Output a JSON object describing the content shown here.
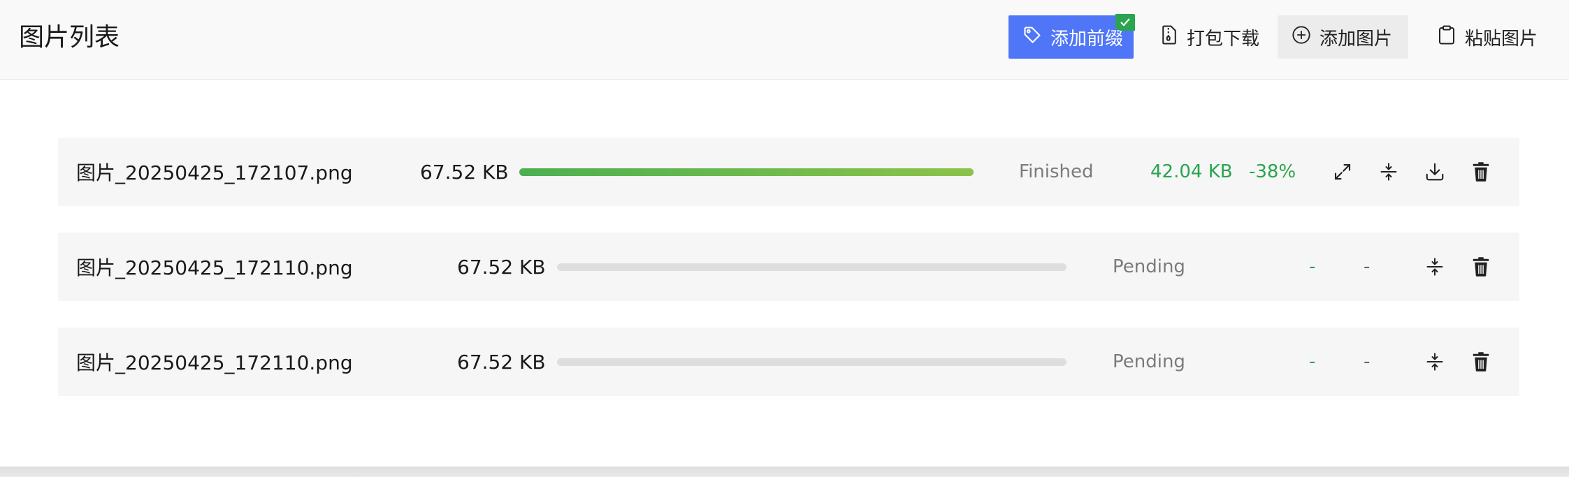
{
  "header": {
    "title": "图片列表",
    "buttons": {
      "add_prefix": "添加前缀",
      "zip_download": "打包下载",
      "add_image": "添加图片",
      "paste_image": "粘贴图片"
    },
    "add_prefix_active": true
  },
  "colors": {
    "accent": "#4f76f6",
    "success": "#2aa44f",
    "progress_start": "#4caf50",
    "progress_end": "#8bc34a"
  },
  "rows": [
    {
      "filename": "图片_20250425_172107.png",
      "size": "67.52 KB",
      "progress": 1.0,
      "status": "Finished",
      "compressed_size": "42.04 KB",
      "ratio": "-38%",
      "actions": [
        "expand-icon",
        "compress-icon",
        "download-icon",
        "trash-icon"
      ]
    },
    {
      "filename": "图片_20250425_172110.png",
      "size": "67.52 KB",
      "progress": 0.0,
      "status": "Pending",
      "compressed_size": "-",
      "ratio": "-",
      "actions": [
        "compress-icon",
        "trash-icon"
      ]
    },
    {
      "filename": "图片_20250425_172110.png",
      "size": "67.52 KB",
      "progress": 0.0,
      "status": "Pending",
      "compressed_size": "-",
      "ratio": "-",
      "actions": [
        "compress-icon",
        "trash-icon"
      ]
    }
  ]
}
